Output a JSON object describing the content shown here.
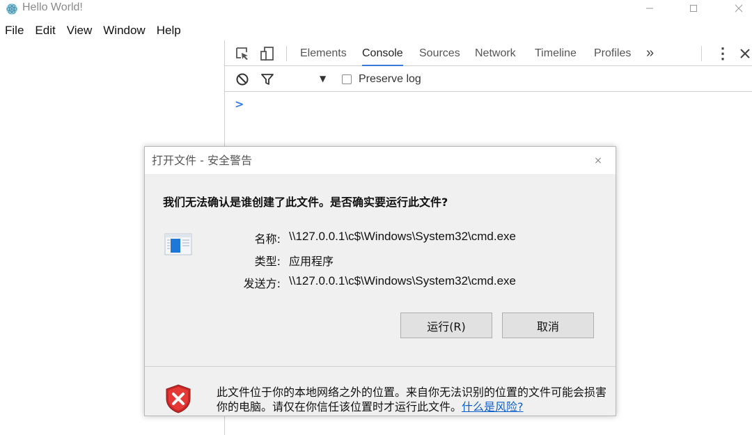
{
  "window": {
    "title": "Hello World!",
    "controls": {
      "minimize": "—",
      "maximize": "☐",
      "close": "✕"
    }
  },
  "menu": {
    "items": [
      "File",
      "Edit",
      "View",
      "Window",
      "Help"
    ]
  },
  "devtools": {
    "tabs": [
      "Elements",
      "Console",
      "Sources",
      "Network",
      "Timeline",
      "Profiles"
    ],
    "active_tab": "Console",
    "more_tabs": "»",
    "menu_dots": "⋮",
    "close": "✕",
    "toolbar": {
      "filter_dropdown_arrow": "▼",
      "preserve_log_label": "Preserve log",
      "preserve_log_checked": false
    },
    "console_prompt": ">",
    "icons": [
      "inspect-element-icon",
      "device-mode-icon",
      "clear-console-icon",
      "filter-icon"
    ]
  },
  "dialog": {
    "title": "打开文件 - 安全警告",
    "close_glyph": "×",
    "question": "我们无法确认是谁创建了此文件。是否确实要运行此文件?",
    "rows": [
      {
        "label": "名称:",
        "value": "\\\\127.0.0.1\\c$\\Windows\\System32\\cmd.exe"
      },
      {
        "label": "类型:",
        "value": "应用程序"
      },
      {
        "label": "发送方:",
        "value": "\\\\127.0.0.1\\c$\\Windows\\System32\\cmd.exe"
      }
    ],
    "run_button": "运行(R)",
    "cancel_button": "取消",
    "warning_text": "此文件位于你的本地网络之外的位置。来自你无法识别的位置的文件可能会损害你的电脑。请仅在你信任该位置时才运行此文件。",
    "warning_link": "什么是风险?"
  },
  "colors": {
    "accent_blue": "#3879d9",
    "link_blue": "#0b5fcc",
    "shield_red": "#d32f2f",
    "dialog_bg": "#f0f0f0"
  }
}
